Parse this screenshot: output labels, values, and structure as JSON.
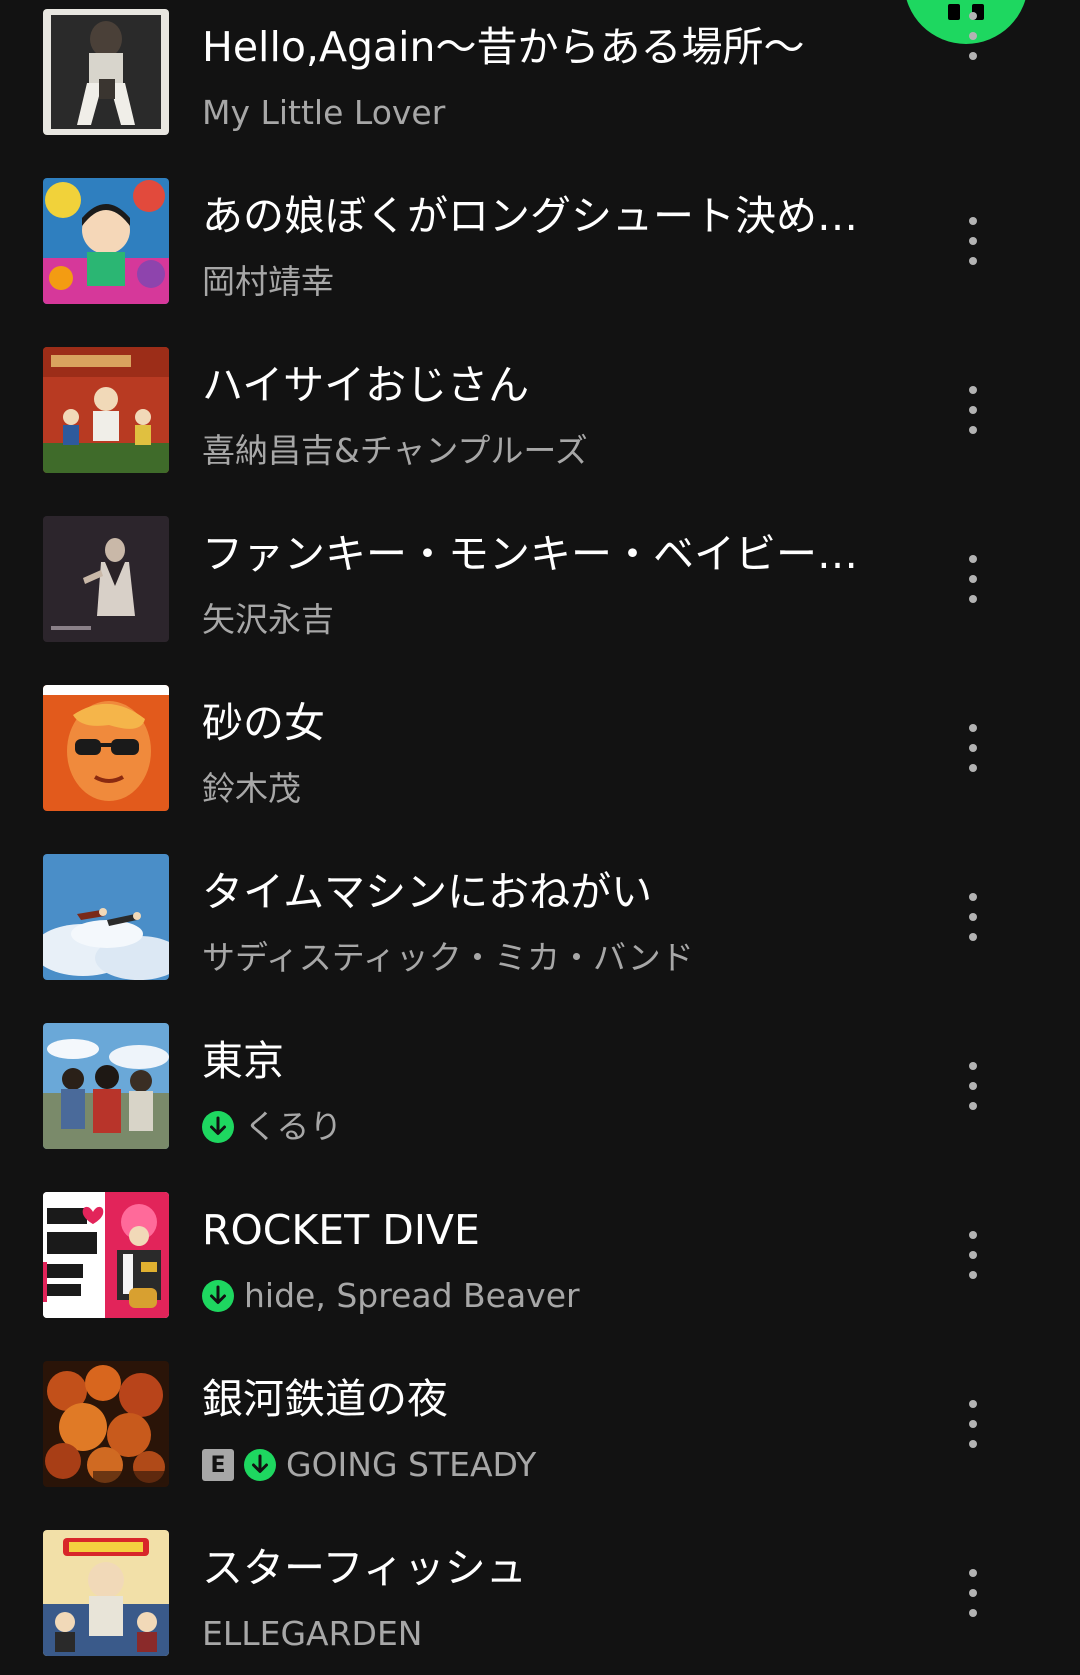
{
  "colors": {
    "background": "#121212",
    "accent": "#1ed760",
    "title": "#ffffff",
    "subtitle": "#a7a7a7"
  },
  "play_button": {
    "icon": "pause-icon"
  },
  "tracks": [
    {
      "title": "Hello,Again〜昔からある場所〜",
      "artist": "My Little Lover",
      "downloaded": false,
      "explicit": false
    },
    {
      "title": "あの娘ぼくがロングシュート決め…",
      "artist": "岡村靖幸",
      "downloaded": false,
      "explicit": false
    },
    {
      "title": "ハイサイおじさん",
      "artist": "喜納昌吉&チャンプルーズ",
      "downloaded": false,
      "explicit": false
    },
    {
      "title": "ファンキー・モンキー・ベイビー (…",
      "artist": "矢沢永吉",
      "downloaded": false,
      "explicit": false
    },
    {
      "title": "砂の女",
      "artist": "鈴木茂",
      "downloaded": false,
      "explicit": false
    },
    {
      "title": "タイムマシンにおねがい",
      "artist": "サディスティック・ミカ・バンド",
      "downloaded": false,
      "explicit": false
    },
    {
      "title": "東京",
      "artist": "くるり",
      "downloaded": true,
      "explicit": false
    },
    {
      "title": "ROCKET DIVE",
      "artist": "hide, Spread Beaver",
      "downloaded": true,
      "explicit": false
    },
    {
      "title": "銀河鉄道の夜",
      "artist": "GOING STEADY",
      "downloaded": true,
      "explicit": true,
      "explicit_label": "E"
    },
    {
      "title": "スターフィッシュ",
      "artist": "ELLEGARDEN",
      "downloaded": false,
      "explicit": false
    }
  ]
}
